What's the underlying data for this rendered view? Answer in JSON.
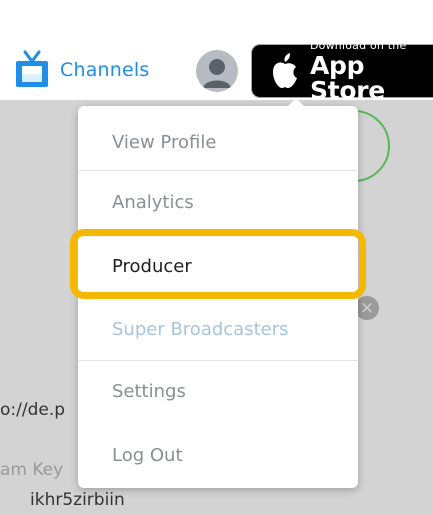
{
  "header": {
    "channels_label": "Channels",
    "channels_icon": "tv-icon",
    "avatar_icon": "user-avatar-icon",
    "appstore": {
      "small_text": "Download on the",
      "big_text": "App Store",
      "icon": "apple-icon"
    }
  },
  "menu": {
    "items": [
      {
        "label": "View Profile"
      },
      {
        "label": "Analytics"
      },
      {
        "label": "Producer"
      },
      {
        "label": "Super Broadcasters"
      },
      {
        "label": "Settings"
      },
      {
        "label": "Log Out"
      }
    ]
  },
  "background": {
    "url_fragment": "o://de.p",
    "key_label_fragment": "am Key",
    "key_value_fragment": "ikhr5zirbiin"
  },
  "colors": {
    "channels_blue": "#1f8ee8",
    "highlight": "#f5b800",
    "circle_green": "#58b758"
  }
}
